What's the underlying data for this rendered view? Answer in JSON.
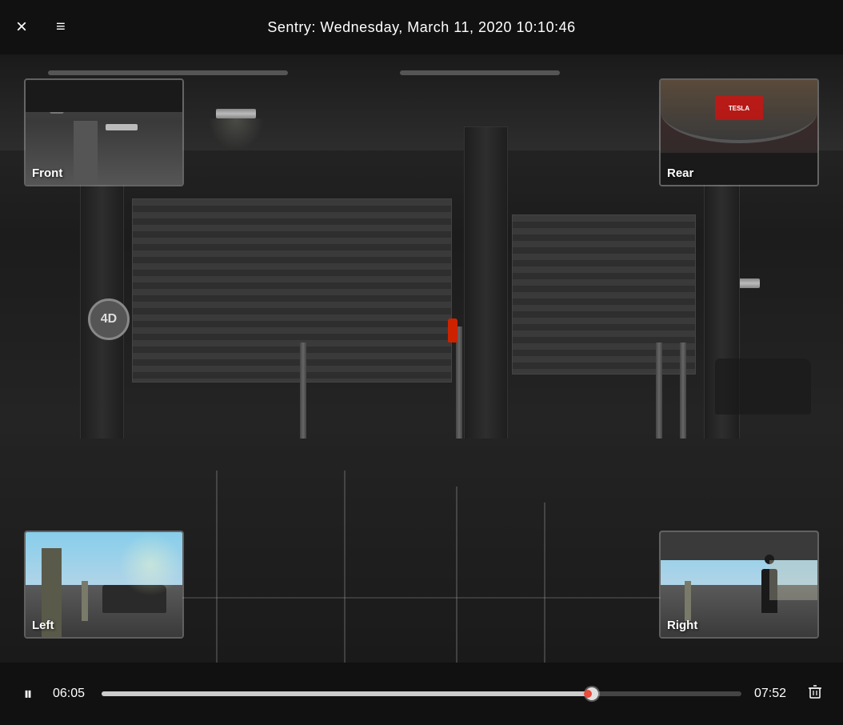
{
  "topbar": {
    "title": "Sentry: Wednesday, March 11, 2020 10:10:46",
    "close_label": "×",
    "menu_label": "≡"
  },
  "thumbnails": {
    "front": {
      "label": "Front",
      "position": "top-left"
    },
    "rear": {
      "label": "Rear",
      "position": "top-right"
    },
    "left": {
      "label": "Left",
      "position": "bottom-left"
    },
    "right": {
      "label": "Right",
      "position": "bottom-right"
    }
  },
  "controls": {
    "pause_label": "⏸",
    "delete_label": "🗑",
    "current_time": "06:05",
    "total_time": "07:52",
    "progress_percent": 77
  },
  "parking_sign": "4D"
}
